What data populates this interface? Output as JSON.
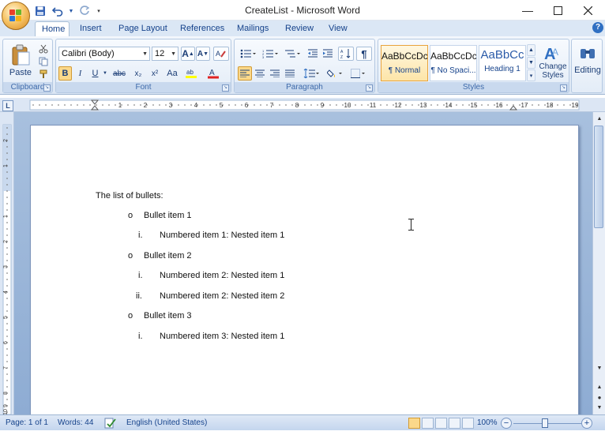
{
  "window": {
    "title": "CreateList - Microsoft Word"
  },
  "tabs": [
    {
      "label": "Home"
    },
    {
      "label": "Insert"
    },
    {
      "label": "Page Layout"
    },
    {
      "label": "References"
    },
    {
      "label": "Mailings"
    },
    {
      "label": "Review"
    },
    {
      "label": "View"
    }
  ],
  "ribbon": {
    "clipboard": {
      "label": "Clipboard",
      "paste_label": "Paste"
    },
    "font": {
      "label": "Font",
      "font_name": "Calibri (Body)",
      "font_size": "12",
      "bold": "B",
      "italic": "I",
      "underline": "U",
      "strike": "abc",
      "subscript": "x₂",
      "superscript": "x²",
      "change_case": "Aa"
    },
    "paragraph": {
      "label": "Paragraph"
    },
    "styles": {
      "label": "Styles",
      "items": [
        {
          "sample": "AaBbCcDc",
          "name": "¶ Normal"
        },
        {
          "sample": "AaBbCcDc",
          "name": "¶ No Spaci..."
        },
        {
          "sample": "AaBbCc",
          "name": "Heading 1"
        }
      ],
      "change_styles": "Change Styles"
    },
    "editing": {
      "label": "Editing"
    }
  },
  "ruler": {
    "h_marks": [
      "1",
      "2",
      "3",
      "4",
      "5",
      "6",
      "7",
      "8",
      "9",
      "10",
      "11",
      "12",
      "13",
      "14",
      "15",
      "16",
      "17",
      "18",
      "19"
    ],
    "v_marks": [
      "2",
      "1",
      "1",
      "2",
      "3",
      "4",
      "5",
      "6",
      "7",
      "8",
      "9",
      "10"
    ]
  },
  "document": {
    "heading": "The list of bullets:",
    "items": [
      {
        "marker": "o",
        "text": "Bullet item 1",
        "level": 1
      },
      {
        "marker": "i.",
        "text": "Numbered item 1: Nested item 1",
        "level": 2
      },
      {
        "marker": "o",
        "text": "Bullet item 2",
        "level": 1
      },
      {
        "marker": "i.",
        "text": "Numbered item 2: Nested item 1",
        "level": 2
      },
      {
        "marker": "ii.",
        "text": "Numbered item 2: Nested item 2",
        "level": 2
      },
      {
        "marker": "o",
        "text": "Bullet item 3",
        "level": 1
      },
      {
        "marker": "i.",
        "text": "Numbered item 3: Nested item 1",
        "level": 2
      }
    ]
  },
  "status": {
    "page": "Page: 1 of 1",
    "words": "Words: 44",
    "language": "English (United States)",
    "zoom": "100%",
    "zoom_out": "−",
    "zoom_in": "+"
  }
}
